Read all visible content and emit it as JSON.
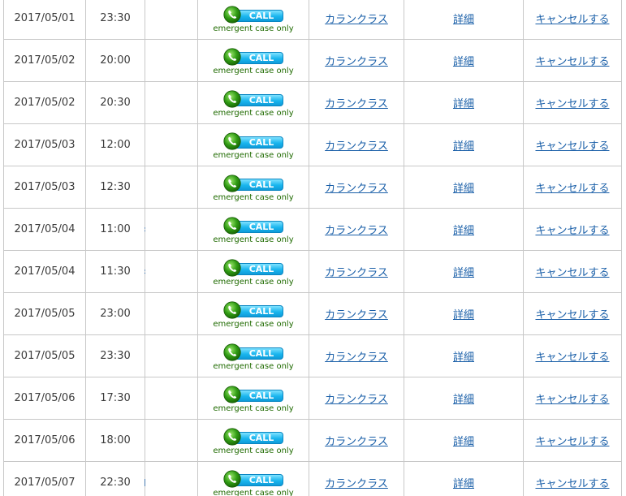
{
  "call_button": {
    "label": "CALL",
    "note": "emergent case only"
  },
  "rows": [
    {
      "date": "2017/05/01",
      "time": "23:30",
      "class_link": "カランクラス",
      "detail_link": "詳細",
      "cancel_link": "キャンセルする",
      "teacher_sliver": ""
    },
    {
      "date": "2017/05/02",
      "time": "20:00",
      "class_link": "カランクラス",
      "detail_link": "詳細",
      "cancel_link": "キャンセルする",
      "teacher_sliver": ""
    },
    {
      "date": "2017/05/02",
      "time": "20:30",
      "class_link": "カランクラス",
      "detail_link": "詳細",
      "cancel_link": "キャンセルする",
      "teacher_sliver": ""
    },
    {
      "date": "2017/05/03",
      "time": "12:00",
      "class_link": "カランクラス",
      "detail_link": "詳細",
      "cancel_link": "キャンセルする",
      "teacher_sliver": ""
    },
    {
      "date": "2017/05/03",
      "time": "12:30",
      "class_link": "カランクラス",
      "detail_link": "詳細",
      "cancel_link": "キャンセルする",
      "teacher_sliver": ""
    },
    {
      "date": "2017/05/04",
      "time": "11:00",
      "class_link": "カランクラス",
      "detail_link": "詳細",
      "cancel_link": "キャンセルする",
      "teacher_sliver": ":"
    },
    {
      "date": "2017/05/04",
      "time": "11:30",
      "class_link": "カランクラス",
      "detail_link": "詳細",
      "cancel_link": "キャンセルする",
      "teacher_sliver": ":"
    },
    {
      "date": "2017/05/05",
      "time": "23:00",
      "class_link": "カランクラス",
      "detail_link": "詳細",
      "cancel_link": "キャンセルする",
      "teacher_sliver": ""
    },
    {
      "date": "2017/05/05",
      "time": "23:30",
      "class_link": "カランクラス",
      "detail_link": "詳細",
      "cancel_link": "キャンセルする",
      "teacher_sliver": ""
    },
    {
      "date": "2017/05/06",
      "time": "17:30",
      "class_link": "カランクラス",
      "detail_link": "詳細",
      "cancel_link": "キャンセルする",
      "teacher_sliver": ""
    },
    {
      "date": "2017/05/06",
      "time": "18:00",
      "class_link": "カランクラス",
      "detail_link": "詳細",
      "cancel_link": "キャンセルする",
      "teacher_sliver": ""
    },
    {
      "date": "2017/05/07",
      "time": "22:30",
      "class_link": "カランクラス",
      "detail_link": "詳細",
      "cancel_link": "キャンセルする",
      "teacher_sliver": "|"
    }
  ]
}
